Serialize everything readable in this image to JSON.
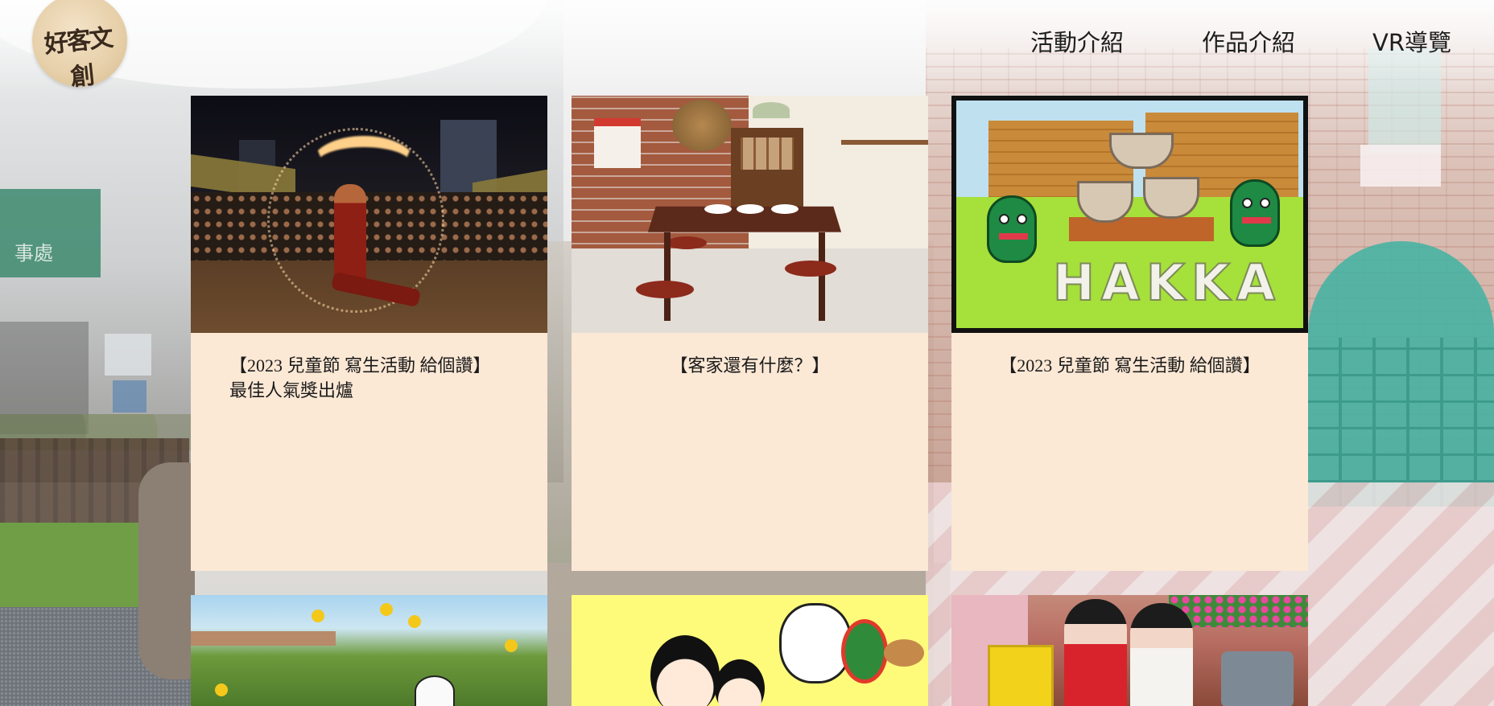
{
  "header": {
    "logo_text": "好客文創",
    "nav": [
      {
        "label": "活動介紹"
      },
      {
        "label": "作品介紹"
      },
      {
        "label": "VR導覽"
      }
    ]
  },
  "background": {
    "sign_text": "事處"
  },
  "cards": [
    {
      "caption_lines": [
        "【2023 兒童節 寫生活動 給個讚】",
        "最佳人氣獎出爐"
      ],
      "image": "fire-dance-night-market-photo"
    },
    {
      "caption_lines": [
        "【客家還有什麼？】"
      ],
      "image": "hakka-dining-room-photo"
    },
    {
      "caption_lines": [
        "【2023 兒童節 寫生活動 給個讚】"
      ],
      "image": "hakka-child-drawing",
      "image_text": "HAKKA"
    },
    {
      "caption_lines": [],
      "image": "flowers-panda-photo"
    },
    {
      "caption_lines": [],
      "image": "cartoon-children-cat-illustration"
    },
    {
      "caption_lines": [],
      "image": "children-at-market-photo"
    }
  ],
  "colors": {
    "card_background": "#fbe8d5",
    "text": "#1b1b1b"
  }
}
